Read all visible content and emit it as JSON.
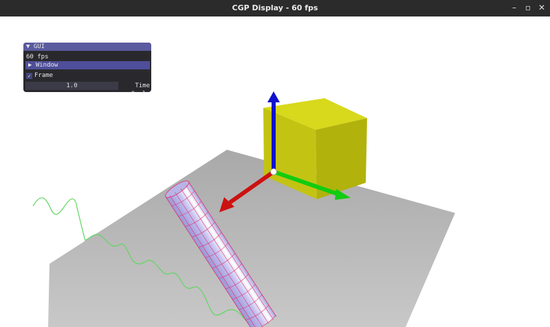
{
  "window": {
    "title": "CGP Display - 60 fps",
    "minimize_glyph": "–",
    "restore_glyph": "▫",
    "close_glyph": "✕"
  },
  "gui": {
    "header": "GUI",
    "header_arrow": "▼",
    "fps_text": "60 fps",
    "window_arrow": "▶",
    "window_label": "Window",
    "frame_label": "Frame",
    "frame_checked": true,
    "check_glyph": "✓",
    "time_scale_value": "1.0",
    "time_scale_label": "Time Scale"
  },
  "scene": {
    "colors": {
      "background": "#ffffff",
      "ground": "#b5b5b5",
      "cube": "#cccc10",
      "cylinder": "#b8b4e6",
      "cylinder_wire": "#e0306a",
      "curve": "#5fd65f",
      "axis_x": "#cc1111",
      "axis_y": "#11cc11",
      "axis_z": "#1111cc"
    },
    "icons": [
      "ground-plane",
      "yellow-cube",
      "wireframe-cylinder",
      "green-helix-curve",
      "xyz-axes"
    ]
  }
}
